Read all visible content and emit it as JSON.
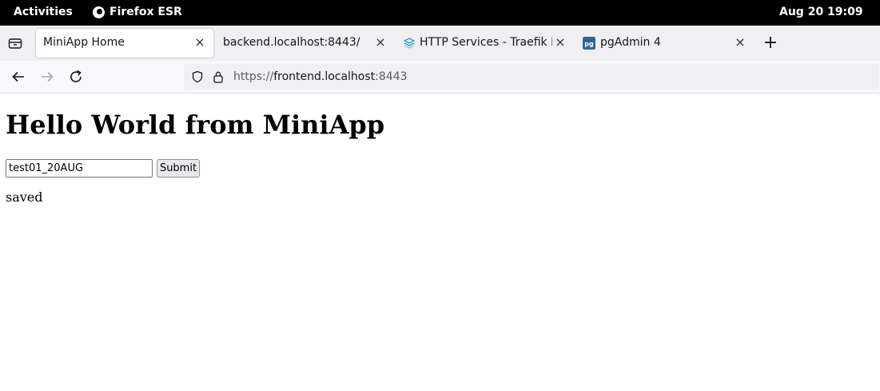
{
  "topbar": {
    "activities": "Activities",
    "app_name": "Firefox ESR",
    "clock": "Aug 20  19:09"
  },
  "tabs": [
    {
      "title": "MiniApp Home",
      "active": true
    },
    {
      "title": "backend.localhost:8443/",
      "active": false
    },
    {
      "title": "HTTP Services - Traefik Proxy",
      "active": false,
      "icon": "traefik-icon"
    },
    {
      "title": "pgAdmin 4",
      "active": false,
      "icon": "pgadmin-icon"
    }
  ],
  "newtab_label": "+",
  "close_label": "×",
  "urlbar": {
    "scheme": "https://",
    "host": "frontend.localhost",
    "port": ":8443"
  },
  "page": {
    "heading": "Hello World from MiniApp",
    "input_value": "test01_20AUG",
    "submit_label": "Submit",
    "status": "saved"
  },
  "colors": {
    "topbar_bg": "#000000",
    "tabstrip_bg": "#f0f0f4",
    "traefik_accent": "#24a1c1",
    "pgadmin_accent": "#326690"
  }
}
